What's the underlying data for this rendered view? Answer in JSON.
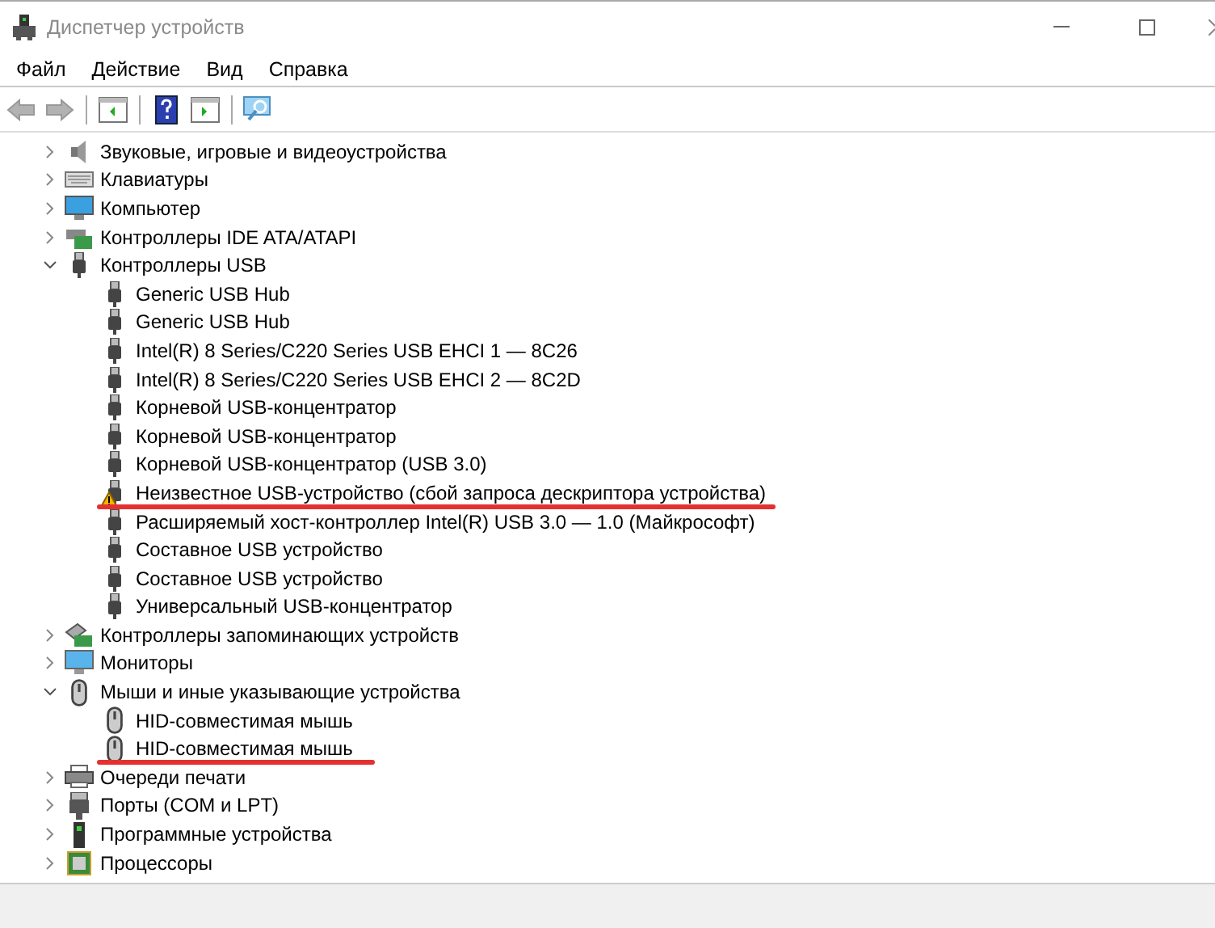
{
  "window": {
    "title": "Диспетчер устройств"
  },
  "menu": [
    "Файл",
    "Действие",
    "Вид",
    "Справка"
  ],
  "toolbar": [
    {
      "kind": "back",
      "disabled": true
    },
    {
      "kind": "forward",
      "disabled": true
    },
    {
      "kind": "sep"
    },
    {
      "kind": "panel"
    },
    {
      "kind": "sep"
    },
    {
      "kind": "help"
    },
    {
      "kind": "panel2"
    },
    {
      "kind": "sep"
    },
    {
      "kind": "scan"
    }
  ],
  "tree": [
    {
      "label": "Звуковые, игровые и видеоустройства",
      "kind": "sound",
      "expanded": false
    },
    {
      "label": "Клавиатуры",
      "kind": "keyboard",
      "expanded": false
    },
    {
      "label": "Компьютер",
      "kind": "computer",
      "expanded": false
    },
    {
      "label": "Контроллеры IDE ATA/ATAPI",
      "kind": "ide",
      "expanded": false
    },
    {
      "label": "Контроллеры USB",
      "kind": "usb",
      "expanded": true,
      "children": [
        {
          "label": "Generic USB Hub",
          "kind": "usb",
          "warning": false,
          "underlined": false
        },
        {
          "label": "Generic USB Hub",
          "kind": "usb",
          "warning": false,
          "underlined": false
        },
        {
          "label": "Intel(R) 8 Series/C220 Series USB EHCI 1 — 8C26",
          "kind": "usb",
          "warning": false,
          "underlined": false
        },
        {
          "label": "Intel(R) 8 Series/C220 Series USB EHCI 2 — 8C2D",
          "kind": "usb",
          "warning": false,
          "underlined": false
        },
        {
          "label": "Корневой USB-концентратор",
          "kind": "usb",
          "warning": false,
          "underlined": false
        },
        {
          "label": "Корневой USB-концентратор",
          "kind": "usb",
          "warning": false,
          "underlined": false
        },
        {
          "label": "Корневой USB-концентратор (USB 3.0)",
          "kind": "usb",
          "warning": false,
          "underlined": false
        },
        {
          "label": "Неизвестное USB-устройство (сбой запроса дескриптора устройства)",
          "kind": "usb",
          "warning": true,
          "underlined": true
        },
        {
          "label": "Расширяемый хост-контроллер Intel(R) USB 3.0 — 1.0 (Майкрософт)",
          "kind": "usb",
          "warning": false,
          "underlined": false
        },
        {
          "label": "Составное USB устройство",
          "kind": "usb",
          "warning": false,
          "underlined": false
        },
        {
          "label": "Составное USB устройство",
          "kind": "usb",
          "warning": false,
          "underlined": false
        },
        {
          "label": "Универсальный USB-концентратор",
          "kind": "usb",
          "warning": false,
          "underlined": false
        }
      ]
    },
    {
      "label": "Контроллеры запоминающих устройств",
      "kind": "storage",
      "expanded": false
    },
    {
      "label": "Мониторы",
      "kind": "monitor",
      "expanded": false
    },
    {
      "label": "Мыши и иные указывающие устройства",
      "kind": "mouse",
      "expanded": true,
      "children": [
        {
          "label": "HID-совместимая мышь",
          "kind": "mouse",
          "warning": false,
          "underlined": false
        },
        {
          "label": "HID-совместимая мышь",
          "kind": "mouse",
          "warning": false,
          "underlined": true
        }
      ]
    },
    {
      "label": "Очереди печати",
      "kind": "printer",
      "expanded": false
    },
    {
      "label": "Порты (COM и LPT)",
      "kind": "port",
      "expanded": false
    },
    {
      "label": "Программные устройства",
      "kind": "software",
      "expanded": false
    },
    {
      "label": "Процессоры",
      "kind": "cpu",
      "expanded": false
    }
  ]
}
